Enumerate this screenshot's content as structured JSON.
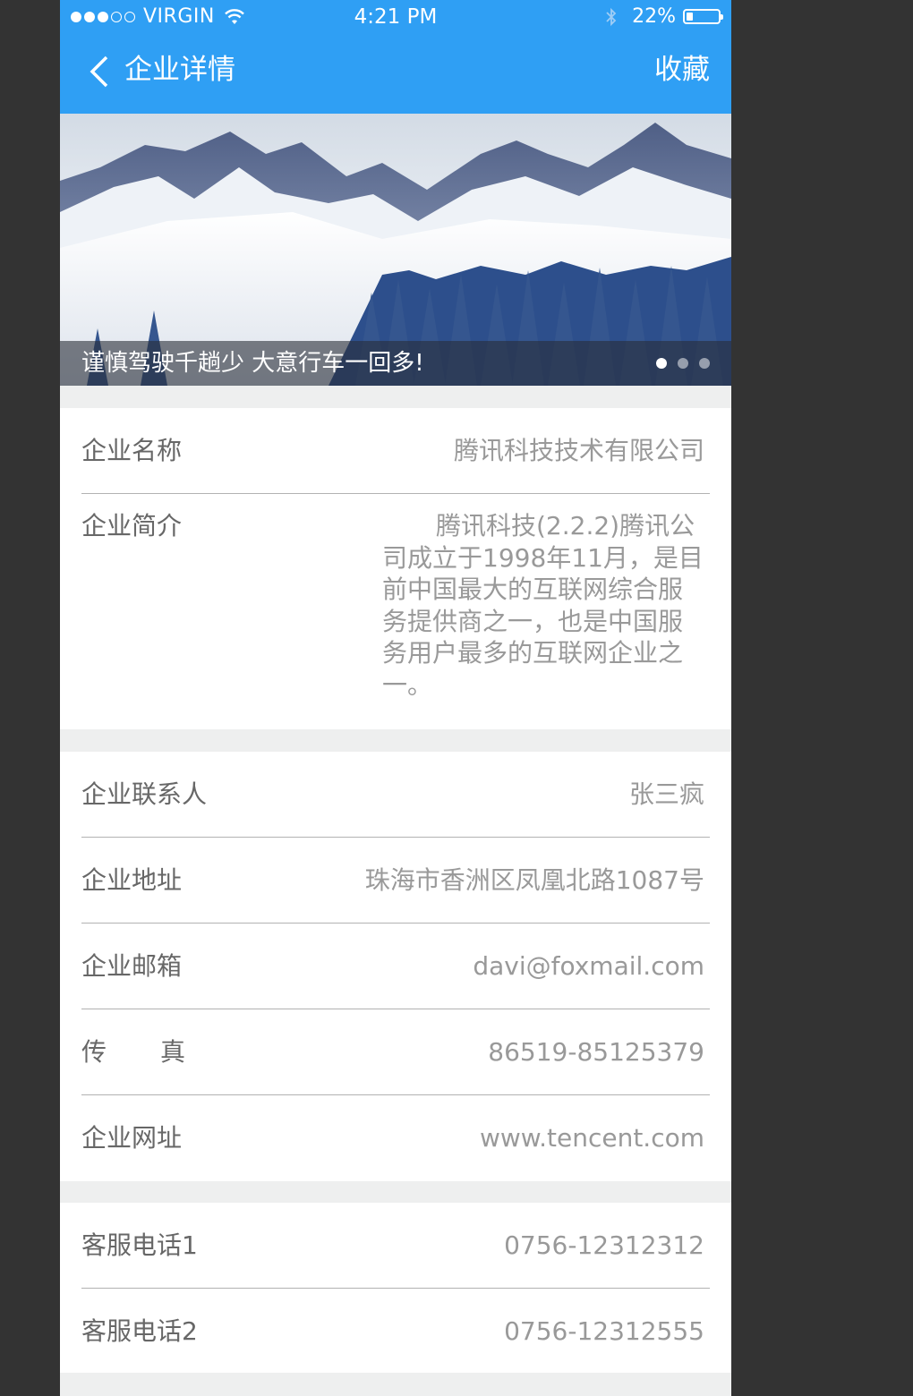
{
  "status_bar": {
    "carrier": "VIRGIN",
    "time": "4:21 PM",
    "battery_percent": "22%",
    "battery_level": 0.22,
    "signal_bars_filled": 3,
    "signal_bars_total": 5
  },
  "nav": {
    "back_icon": "chevron-left-icon",
    "title": "企业详情",
    "favorite_label": "收藏"
  },
  "banner": {
    "caption": "谨慎驾驶千趟少 大意行车一回多!",
    "slide_count": 3,
    "active_slide": 1
  },
  "company": {
    "name_label": "企业名称",
    "name_value": "腾讯科技技术有限公司",
    "intro_label": "企业简介",
    "intro_value": "腾讯科技(2.2.2)腾讯公司成立于1998年11月，是目前中国最大的互联网综合服务提供商之一，也是中国服务用户最多的互联网企业之一。"
  },
  "contact": {
    "contact_label": "企业联系人",
    "contact_value": "张三疯",
    "address_label": "企业地址",
    "address_value": "珠海市香洲区凤凰北路1087号",
    "email_label": "企业邮箱",
    "email_value": "davi@foxmail.com",
    "fax_label_1": "传",
    "fax_label_2": "真",
    "fax_value": "86519-85125379",
    "website_label": "企业网址",
    "website_value": "www.tencent.com"
  },
  "service": {
    "phone1_label": "客服电话1",
    "phone1_value": "0756-12312312",
    "phone2_label": "客服电话2",
    "phone2_value": "0756-12312555"
  },
  "colors": {
    "header_bg": "#2f9ff4",
    "page_bg": "#eeefef",
    "label_text": "#676767",
    "value_text": "#999999",
    "divider": "#b2b2b2"
  }
}
